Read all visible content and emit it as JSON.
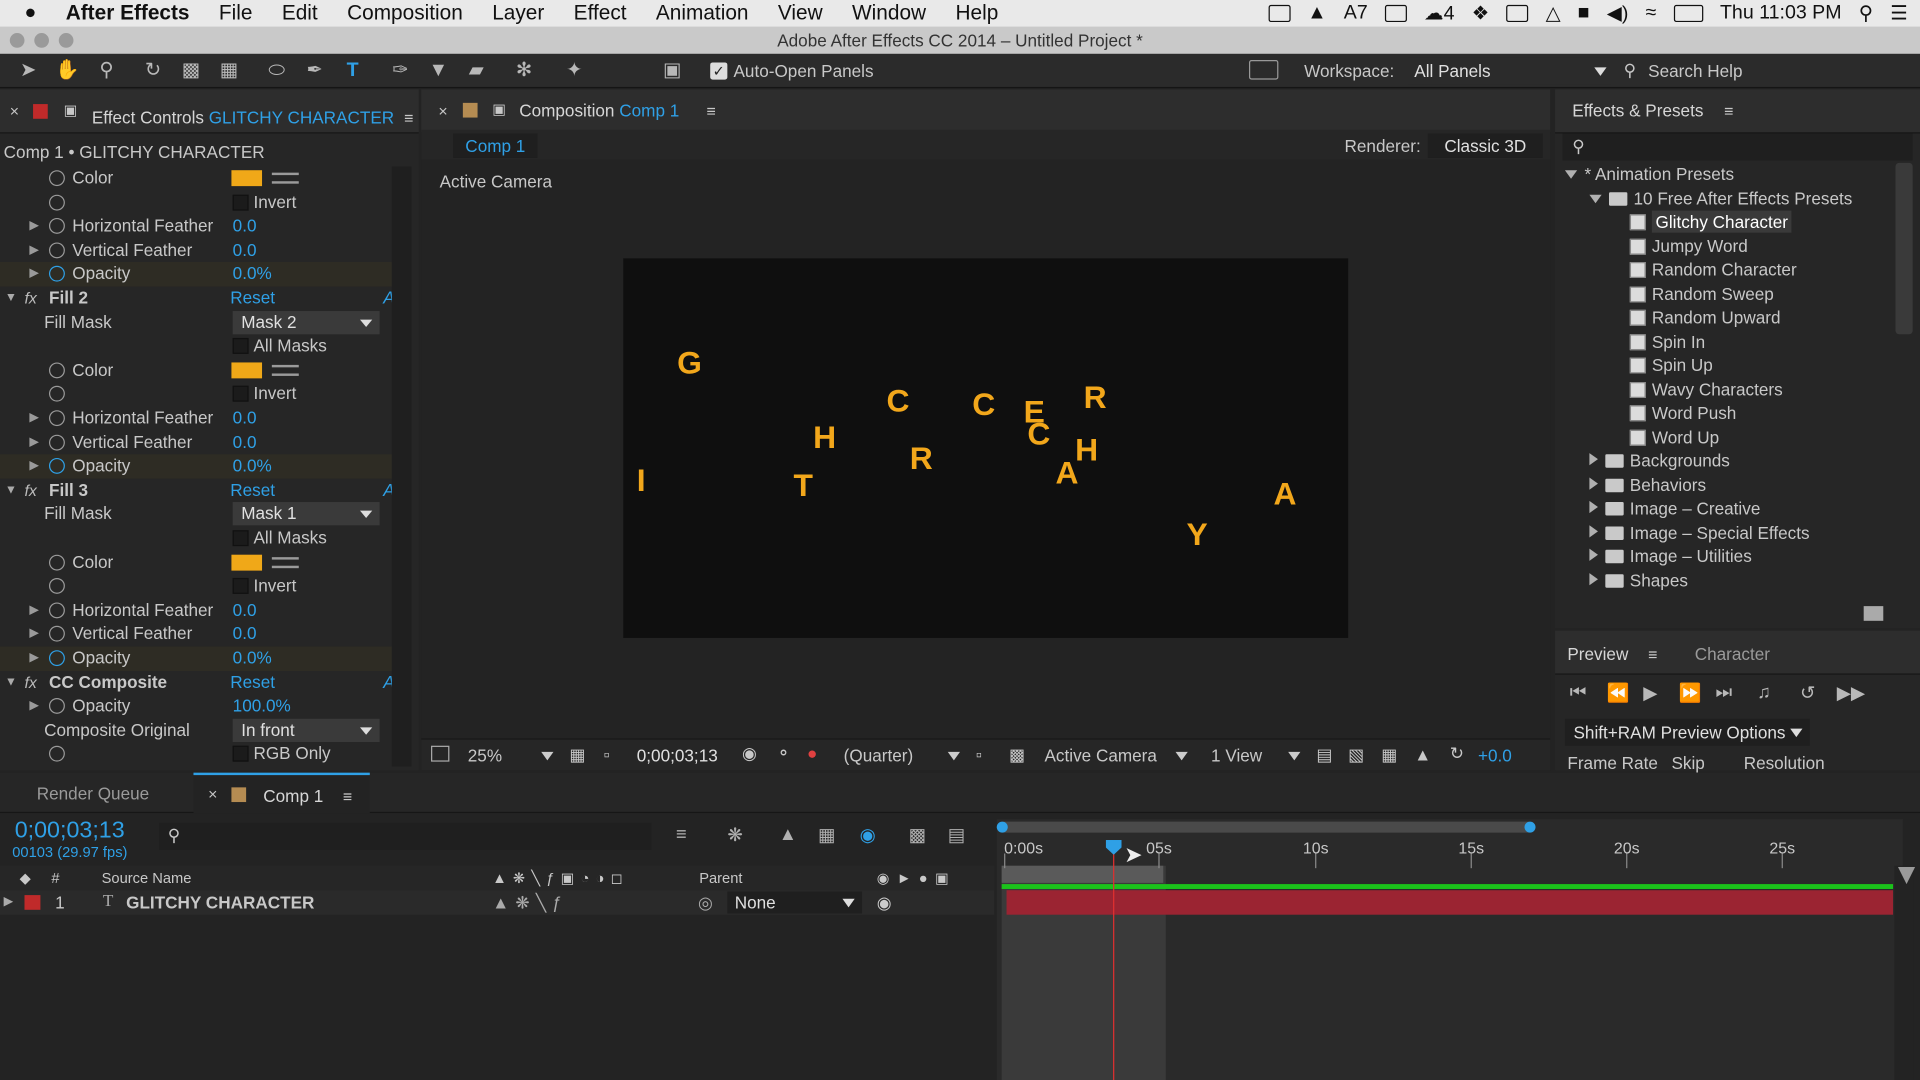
{
  "menubar": {
    "apple": "",
    "app": "After Effects",
    "items": [
      "File",
      "Edit",
      "Composition",
      "Layer",
      "Effect",
      "Animation",
      "View",
      "Window",
      "Help"
    ],
    "status_num1": "7",
    "status_num2": "4",
    "clock": "Thu 11:03 PM"
  },
  "titlebar": {
    "title": "Adobe After Effects CC 2014 – Untitled Project *"
  },
  "toolbar": {
    "auto_open": "Auto-Open Panels",
    "workspace_label": "Workspace:",
    "workspace_value": "All Panels",
    "search_help": "Search Help"
  },
  "effect_controls": {
    "tab_prefix": "Effect Controls",
    "tab_layer": "GLITCHY CHARACTER",
    "breadcrumb": "Comp 1 • GLITCHY CHARACTER",
    "rows": [
      {
        "type": "color",
        "label": "Color"
      },
      {
        "type": "check",
        "label": "Invert"
      },
      {
        "type": "value",
        "label": "Horizontal Feather",
        "value": "0.0"
      },
      {
        "type": "value",
        "label": "Vertical Feather",
        "value": "0.0"
      },
      {
        "type": "value",
        "label": "Opacity",
        "value": "0.0%",
        "hl": true
      },
      {
        "type": "fx",
        "label": "Fill 2",
        "reset": "Reset"
      },
      {
        "type": "dropdown",
        "label": "Fill Mask",
        "value": "Mask 2"
      },
      {
        "type": "check",
        "label": "All Masks",
        "noicon": true
      },
      {
        "type": "color",
        "label": "Color"
      },
      {
        "type": "check",
        "label": "Invert"
      },
      {
        "type": "value",
        "label": "Horizontal Feather",
        "value": "0.0"
      },
      {
        "type": "value",
        "label": "Vertical Feather",
        "value": "0.0"
      },
      {
        "type": "value",
        "label": "Opacity",
        "value": "0.0%",
        "hl": true
      },
      {
        "type": "fx",
        "label": "Fill 3",
        "reset": "Reset"
      },
      {
        "type": "dropdown",
        "label": "Fill Mask",
        "value": "Mask 1"
      },
      {
        "type": "check",
        "label": "All Masks",
        "noicon": true
      },
      {
        "type": "color",
        "label": "Color"
      },
      {
        "type": "check",
        "label": "Invert"
      },
      {
        "type": "value",
        "label": "Horizontal Feather",
        "value": "0.0"
      },
      {
        "type": "value",
        "label": "Vertical Feather",
        "value": "0.0"
      },
      {
        "type": "value",
        "label": "Opacity",
        "value": "0.0%",
        "hl": true
      },
      {
        "type": "fx",
        "label": "CC Composite",
        "reset": "Reset"
      },
      {
        "type": "value",
        "label": "Opacity",
        "value": "100.0%"
      },
      {
        "type": "dropdown",
        "label": "Composite Original",
        "value": "In front",
        "noicon": true
      },
      {
        "type": "check",
        "label": "RGB Only"
      }
    ]
  },
  "composition": {
    "tab_prefix": "Composition",
    "tab_comp": "Comp 1",
    "sub_tab": "Comp 1",
    "renderer_label": "Renderer:",
    "renderer_value": "Classic 3D",
    "camera_label": "Active Camera",
    "letters": [
      "G",
      "C",
      "C",
      "E",
      "R",
      "H",
      "C",
      "H",
      "R",
      "I",
      "T",
      "A",
      "A",
      "Y"
    ],
    "footer": {
      "zoom": "25%",
      "timecode": "0;00;03;13",
      "quality": "(Quarter)",
      "camera": "Active Camera",
      "view": "1 View",
      "exposure": "+0.0"
    }
  },
  "effects_presets": {
    "title": "Effects & Presets",
    "search_placeholder": "",
    "tree": [
      {
        "label": "* Animation Presets",
        "depth": 0,
        "kind": "root",
        "open": true
      },
      {
        "label": "10 Free After Effects Presets",
        "depth": 1,
        "kind": "folder",
        "open": true
      },
      {
        "label": "Glitchy Character",
        "depth": 2,
        "kind": "preset",
        "selected": true
      },
      {
        "label": "Jumpy Word",
        "depth": 2,
        "kind": "preset"
      },
      {
        "label": "Random Character",
        "depth": 2,
        "kind": "preset"
      },
      {
        "label": "Random Sweep",
        "depth": 2,
        "kind": "preset"
      },
      {
        "label": "Random Upward",
        "depth": 2,
        "kind": "preset"
      },
      {
        "label": "Spin In",
        "depth": 2,
        "kind": "preset"
      },
      {
        "label": "Spin Up",
        "depth": 2,
        "kind": "preset"
      },
      {
        "label": "Wavy Characters",
        "depth": 2,
        "kind": "preset"
      },
      {
        "label": "Word Push",
        "depth": 2,
        "kind": "preset"
      },
      {
        "label": "Word Up",
        "depth": 2,
        "kind": "preset"
      },
      {
        "label": "Backgrounds",
        "depth": 1,
        "kind": "folder"
      },
      {
        "label": "Behaviors",
        "depth": 1,
        "kind": "folder"
      },
      {
        "label": "Image – Creative",
        "depth": 1,
        "kind": "folder"
      },
      {
        "label": "Image – Special Effects",
        "depth": 1,
        "kind": "folder"
      },
      {
        "label": "Image – Utilities",
        "depth": 1,
        "kind": "folder"
      },
      {
        "label": "Shapes",
        "depth": 1,
        "kind": "folder"
      }
    ]
  },
  "preview": {
    "tab_preview": "Preview",
    "tab_character": "Character",
    "ram_options": "Shift+RAM Preview Options",
    "frame_rate": "Frame Rate",
    "skip": "Skip",
    "resolution": "Resolution"
  },
  "timeline": {
    "render_queue": "Render Queue",
    "comp_tab": "Comp 1",
    "timecode": "0;00;03;13",
    "frames": "00103 (29.97 fps)",
    "headers": {
      "num": "#",
      "source": "Source Name",
      "parent": "Parent"
    },
    "layer": {
      "num": "1",
      "name": "GLITCHY CHARACTER",
      "parent": "None"
    },
    "ruler": [
      "0:00s",
      "05s",
      "10s",
      "15s",
      "20s",
      "25s"
    ]
  },
  "colors": {
    "accent": "#2fa0e6",
    "letters": "#f2a71b",
    "layer_bar": "#9b2432",
    "playhead": "#e03030"
  }
}
